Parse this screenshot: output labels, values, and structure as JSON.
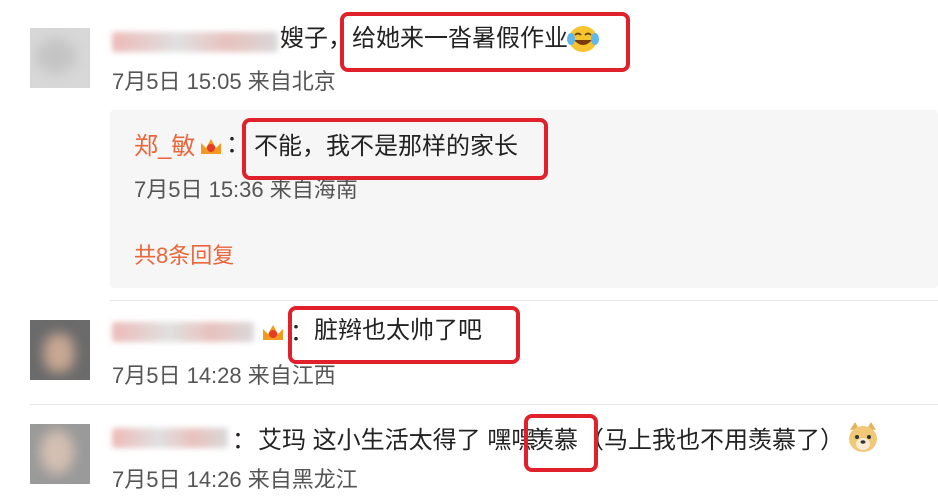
{
  "comment1": {
    "text_a": "嫂子，",
    "text_b": "给她来一沓暑假作业",
    "emoji": "laughing-tears-icon",
    "meta": "7月5日 15:05 来自北京"
  },
  "reply": {
    "name": "郑_敏",
    "badge": "crown-vip-icon",
    "colon": "：",
    "text": "不能，我不是那样的家长",
    "meta": "7月5日 15:36 来自海南",
    "more_label": "共8条回复"
  },
  "comment2": {
    "colon": "：",
    "text": "脏辫也太帅了吧",
    "badge": "crown-vip-icon",
    "meta": "7月5日 14:28 来自江西"
  },
  "comment3": {
    "colon": "：",
    "text_a": "艾玛 这小生活太得了 嘿嘿",
    "text_b": "羡慕",
    "text_c": "（马上我也不用羡慕了）",
    "emoji": "doge-icon",
    "meta": "7月5日 14:26 来自黑龙江"
  },
  "colors": {
    "highlight": "#e0202a",
    "username": "#e9663b",
    "reply_bg": "#f6f6f6"
  }
}
